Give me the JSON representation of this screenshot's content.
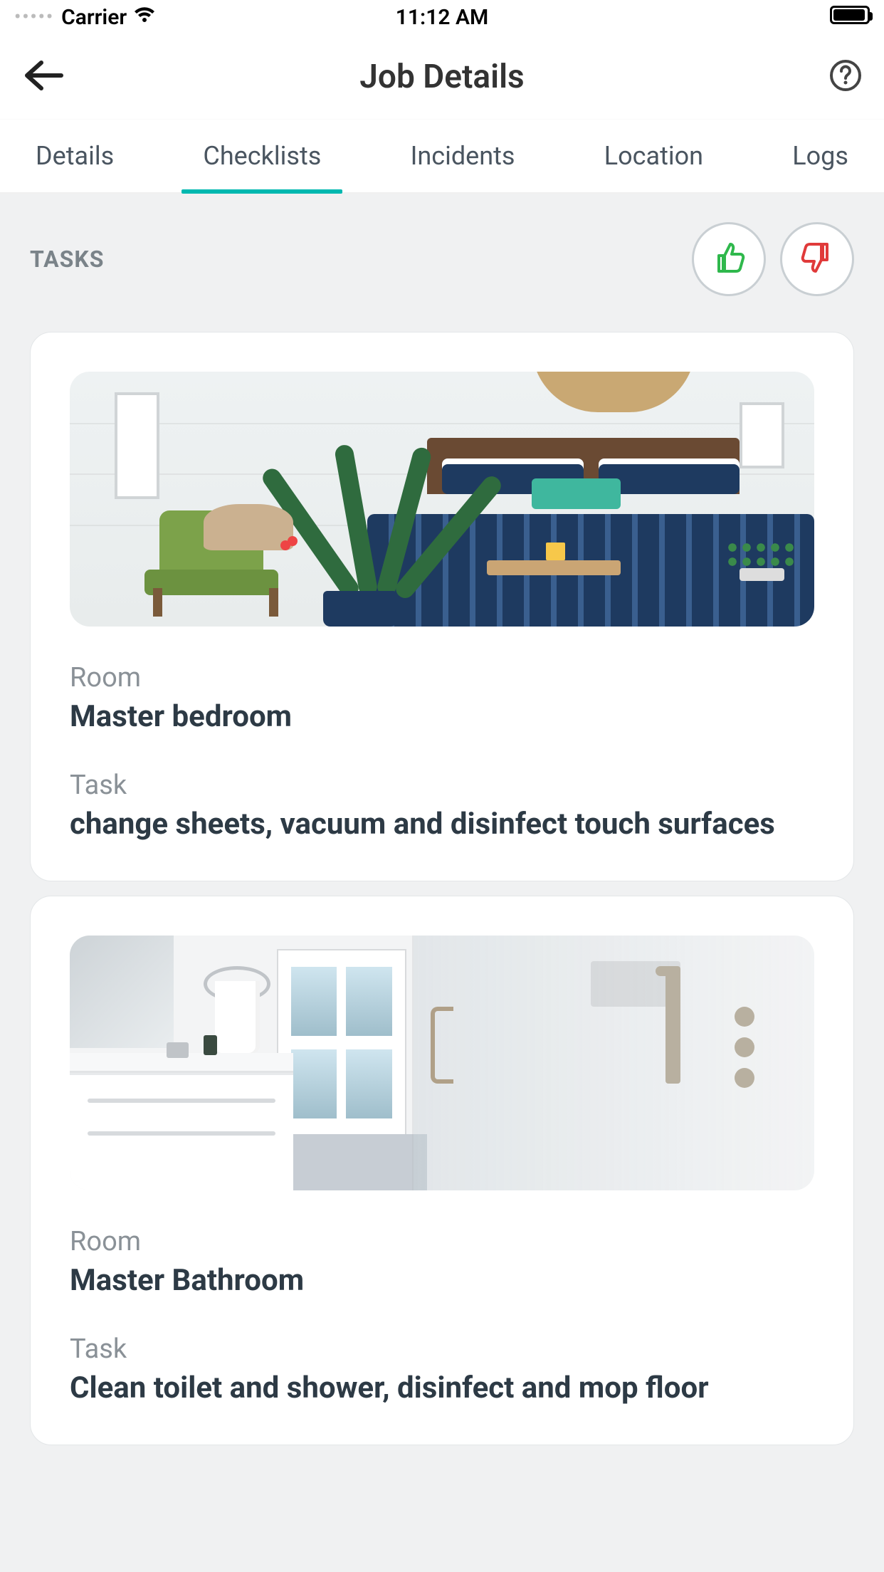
{
  "status_bar": {
    "carrier": "Carrier",
    "time": "11:12 AM"
  },
  "header": {
    "title": "Job Details"
  },
  "tabs": [
    {
      "label": "Details",
      "active": false
    },
    {
      "label": "Checklists",
      "active": true
    },
    {
      "label": "Incidents",
      "active": false
    },
    {
      "label": "Location",
      "active": false
    },
    {
      "label": "Logs",
      "active": false
    }
  ],
  "section": {
    "title": "TASKS"
  },
  "labels": {
    "room": "Room",
    "task": "Task"
  },
  "tasks": [
    {
      "room": "Master bedroom",
      "task": "change sheets, vacuum and disinfect touch surfaces"
    },
    {
      "room": "Master Bathroom",
      "task": "Clean toilet and shower, disinfect and mop floor"
    }
  ],
  "colors": {
    "accent": "#00b8b0",
    "thumbs_up": "#2fb84c",
    "thumbs_down": "#e03a3a"
  }
}
